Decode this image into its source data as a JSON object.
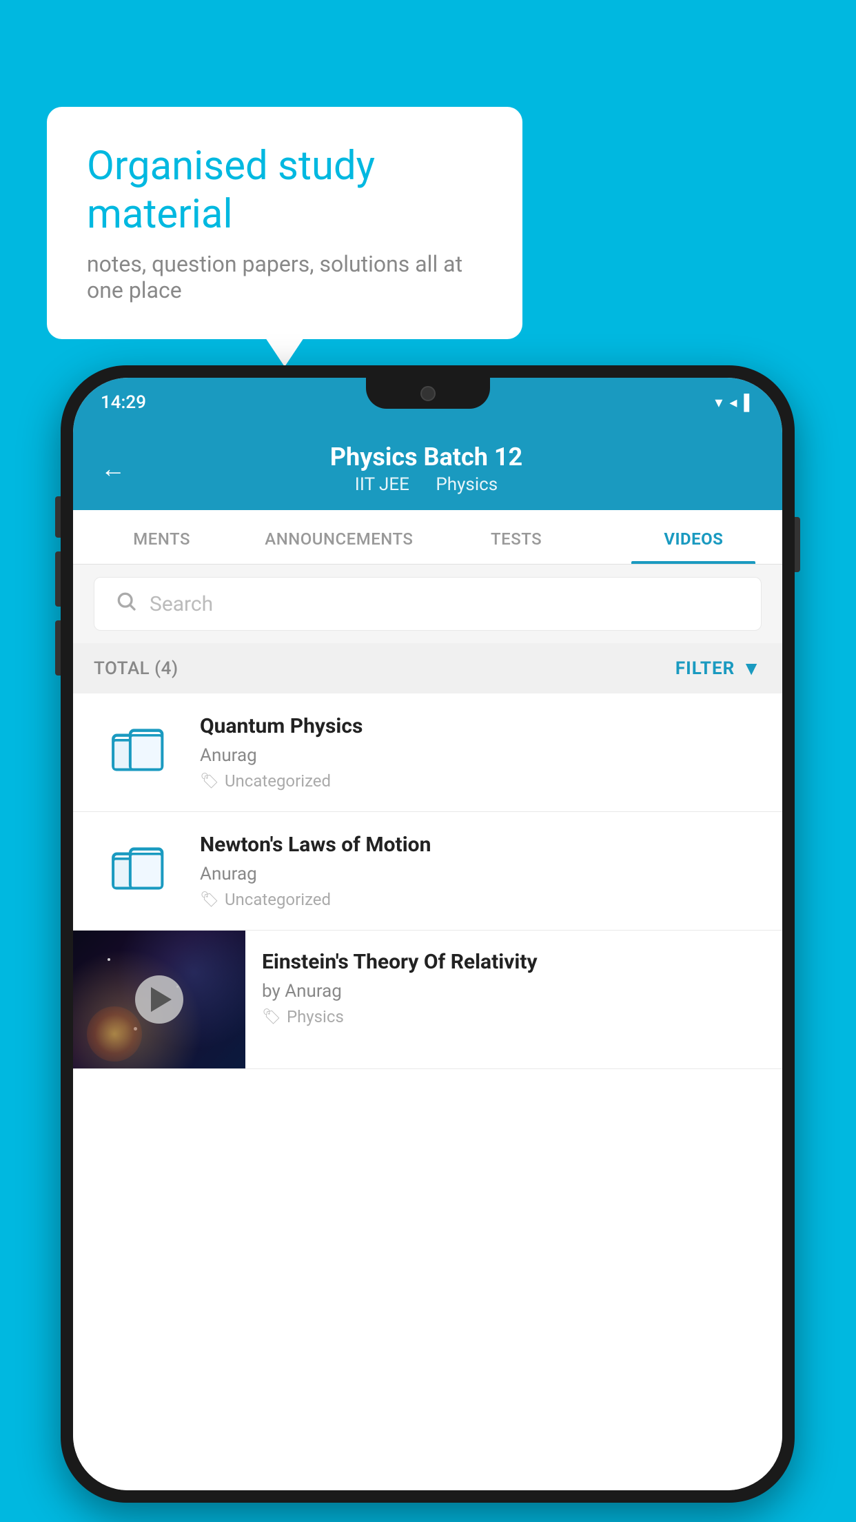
{
  "background": {
    "color": "#00b8e0"
  },
  "speech_bubble": {
    "title": "Organised study material",
    "subtitle": "notes, question papers, solutions all at one place"
  },
  "phone": {
    "status_bar": {
      "time": "14:29",
      "icons": "▼◄▌"
    },
    "header": {
      "back_label": "←",
      "title": "Physics Batch 12",
      "subtitle_part1": "IIT JEE",
      "subtitle_part2": "Physics"
    },
    "tabs": [
      {
        "label": "MENTS",
        "active": false
      },
      {
        "label": "ANNOUNCEMENTS",
        "active": false
      },
      {
        "label": "TESTS",
        "active": false
      },
      {
        "label": "VIDEOS",
        "active": true
      }
    ],
    "search": {
      "placeholder": "Search"
    },
    "filter_bar": {
      "total_label": "TOTAL (4)",
      "filter_label": "FILTER"
    },
    "videos": [
      {
        "id": "quantum",
        "title": "Quantum Physics",
        "author": "Anurag",
        "tag": "Uncategorized",
        "has_thumbnail": false
      },
      {
        "id": "newton",
        "title": "Newton's Laws of Motion",
        "author": "Anurag",
        "tag": "Uncategorized",
        "has_thumbnail": false
      },
      {
        "id": "einstein",
        "title": "Einstein's Theory Of Relativity",
        "author": "by Anurag",
        "tag": "Physics",
        "has_thumbnail": true
      }
    ]
  }
}
